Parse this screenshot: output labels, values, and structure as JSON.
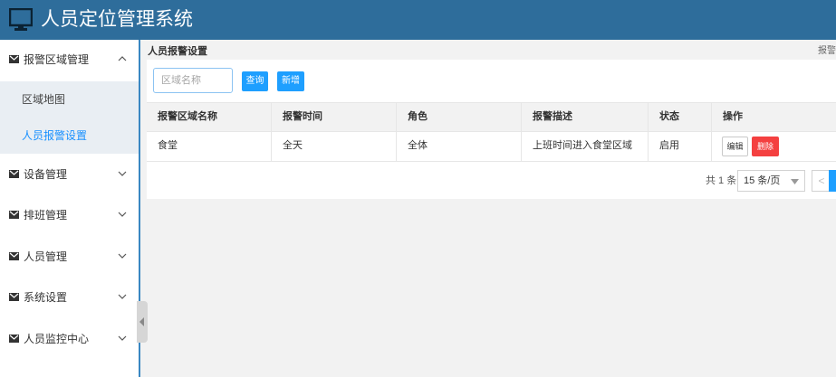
{
  "header": {
    "title": "人员定位管理系统"
  },
  "sidebar": {
    "groups": [
      {
        "label": "报警区域管理",
        "expanded": true
      },
      {
        "label": "设备管理"
      },
      {
        "label": "排班管理"
      },
      {
        "label": "人员管理"
      },
      {
        "label": "系统设置"
      },
      {
        "label": "人员监控中心"
      }
    ],
    "subitems": [
      {
        "label": "区域地图"
      },
      {
        "label": "人员报警设置",
        "active": true
      }
    ]
  },
  "content": {
    "title": "人员报警设置",
    "breadcrumb": "报警",
    "search": {
      "placeholder": "区域名称",
      "value": ""
    },
    "query_label": "查询",
    "add_label": "新增",
    "table": {
      "headers": [
        "报警区域名称",
        "报警时间",
        "角色",
        "报警描述",
        "状态",
        "操作"
      ],
      "rows": [
        {
          "area": "食堂",
          "time": "全天",
          "role": "全体",
          "desc": "上班时间进入食堂区域",
          "status": "启用",
          "edit": "编辑",
          "delete": "删除"
        }
      ]
    },
    "pager": {
      "total": "共 1 条",
      "page_size": "15 条/页",
      "prev": "<"
    }
  },
  "colors": {
    "header": "#2e6d9b",
    "accent": "#1e9fff",
    "danger": "#f44040"
  },
  "icons": {
    "logo": "monitor-icon",
    "menu": "envelope-icon",
    "chevron_up": "chevron-up-icon",
    "chevron_down": "chevron-down-icon"
  }
}
